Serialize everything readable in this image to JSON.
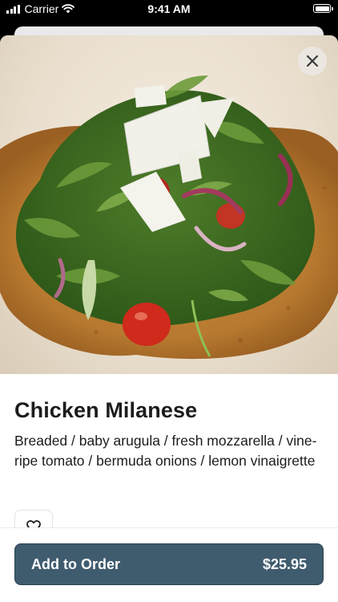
{
  "status_bar": {
    "carrier": "Carrier",
    "time": "9:41 AM"
  },
  "item": {
    "image_alt": "Chicken Milanese topped with arugula salad",
    "title": "Chicken Milanese",
    "description": "Breaded / baby arugula / fresh mozzarella / vine-ripe tomato / bermuda onions / lemon vinaigrette"
  },
  "actions": {
    "add_label": "Add to Order",
    "price": "$25.95"
  },
  "icons": {
    "close": "close-icon",
    "favorite": "heart-icon",
    "signal": "cellular-signal-icon",
    "wifi": "wifi-icon",
    "battery": "battery-icon"
  },
  "colors": {
    "primary_button": "#3f5b6e",
    "text": "#1c1c1e"
  }
}
